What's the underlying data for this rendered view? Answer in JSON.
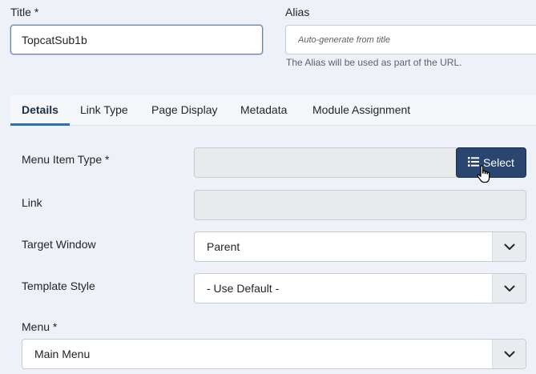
{
  "title_field": {
    "label": "Title *",
    "value": "TopcatSub1b"
  },
  "alias_field": {
    "label": "Alias",
    "placeholder": "Auto-generate from title",
    "hint": "The Alias will be used as part of the URL."
  },
  "tabs": [
    {
      "label": "Details",
      "active": true
    },
    {
      "label": "Link Type"
    },
    {
      "label": "Page Display"
    },
    {
      "label": "Metadata"
    },
    {
      "label": "Module Assignment"
    }
  ],
  "details": {
    "menu_item_type": {
      "label": "Menu Item Type *",
      "value": "",
      "button_label": "Select",
      "button_icon": "list-icon"
    },
    "link": {
      "label": "Link",
      "value": ""
    },
    "target_window": {
      "label": "Target Window",
      "value": "Parent"
    },
    "template_style": {
      "label": "Template Style",
      "value": "- Use Default -"
    },
    "menu": {
      "label": "Menu *",
      "value": "Main Menu"
    }
  },
  "colors": {
    "accent": "#2a4570",
    "background": "#eef2f8",
    "active_tab": "#3c6aa6"
  }
}
